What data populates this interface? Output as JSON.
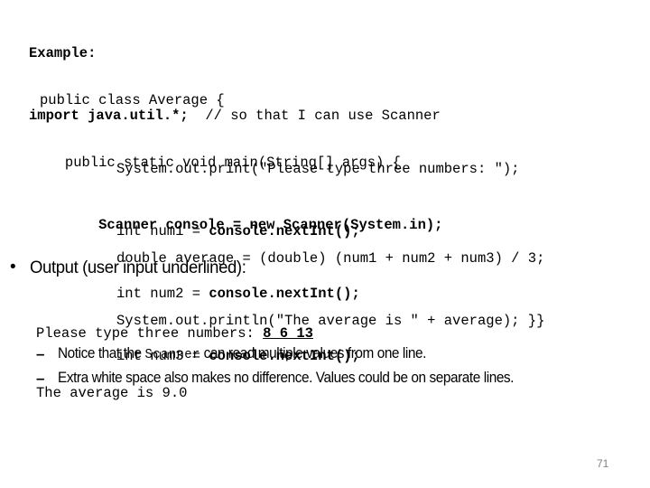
{
  "slide": {
    "page_number": "71",
    "page_number_color": "#808080",
    "background_color": "#ffffff",
    "text_color": "#000000"
  },
  "code": {
    "header_group": [
      {
        "text": "Example:",
        "bold": true
      },
      {
        "text": "import java.util.*;",
        "bold": true,
        "comment": "  // so that I can use Scanner"
      }
    ],
    "class_group": [
      {
        "text": "public class Average {",
        "bold": false
      },
      {
        "text": "   public static void main(String[] args) {",
        "bold": false
      },
      {
        "text": "       Scanner console = new Scanner(System.in);",
        "bold": true
      }
    ],
    "body_group": [
      {
        "text": "System.out.print(\"Please type three numbers: \");",
        "bold": false
      },
      {
        "prefix": "int num1 = ",
        "bold_part": "console.nextInt();"
      },
      {
        "prefix": "int num2 = ",
        "bold_part": "console.nextInt();"
      },
      {
        "prefix": "int num3 = ",
        "bold_part": "console.nextInt();"
      }
    ],
    "tail_group": [
      {
        "text": "double average = (double) (num1 + num2 + num3) / 3;"
      },
      {
        "text": "System.out.println(\"The average is \" + average); }}"
      }
    ]
  },
  "bullets": {
    "main": {
      "marker": "•",
      "label": "Output (user input underlined):"
    },
    "console_output": {
      "line1_prefix": "Please type three numbers: ",
      "line1_user_input": "8 6 13",
      "line2": "The average is 9.0"
    },
    "sub_items": [
      {
        "marker": "–",
        "before": "Notice that the ",
        "mono": "Scanner",
        "after": " can read multiple values from one line."
      },
      {
        "marker": "–",
        "before": "Extra white space also makes no difference.  Values could be on separate lines.",
        "mono": "",
        "after": ""
      }
    ]
  }
}
